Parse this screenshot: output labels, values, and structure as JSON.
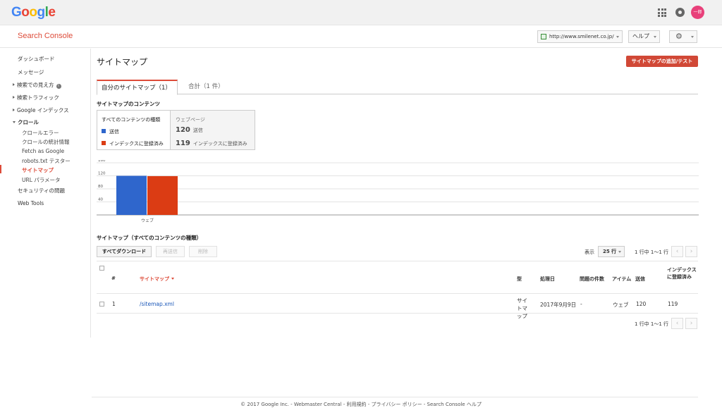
{
  "colors": {
    "brand_red": "#dd4b39",
    "sent": "#2f66cc",
    "indexed": "#db3c14",
    "link": "#1a57b8"
  },
  "topbar": {
    "logo": "Google",
    "avatar_text": "一郎"
  },
  "header": {
    "title": "Search Console",
    "site": "http://www.smilenet.co.jp/",
    "help": "ヘルプ",
    "gear": "⚙"
  },
  "sidebar": {
    "dashboard": "ダッシュボード",
    "messages": "メッセージ",
    "search_appearance": "検索での見え方",
    "search_traffic": "検索トラフィック",
    "google_index": "Google インデックス",
    "crawl": "クロール",
    "crawl_errors": "クロールエラー",
    "crawl_stats": "クロールの統計情報",
    "fetch_as_google": "Fetch as Google",
    "robots_tester": "robots.txt テスター",
    "sitemaps": "サイトマップ",
    "url_params": "URL パラメータ",
    "security": "セキュリティの問題",
    "web_tools": "Web Tools"
  },
  "main": {
    "title": "サイトマップ",
    "add_button": "サイトマップの追加/テスト",
    "tabs": [
      {
        "label": "自分のサイトマップ（1）"
      },
      {
        "label": "合計（1 件）"
      }
    ],
    "contents_title": "サイトマップのコンテンツ",
    "legend": {
      "header": "すべてのコンテンツの種類",
      "sent": "送信",
      "indexed": "インデックスに登録済み"
    },
    "stats": {
      "header": "ウェブページ",
      "sent_value": "120",
      "sent_label": "送信",
      "indexed_value": "119",
      "indexed_label": "インデックスに登録済み"
    },
    "table_title": "サイトマップ（すべてのコンテンツの種類）",
    "buttons": {
      "download_all": "すべてダウンロード",
      "resubmit": "再送信",
      "delete": "削除"
    },
    "show_label": "表示",
    "rows_per_page": "25 行",
    "page_info": "1 行中 1～1 行",
    "pager_prev": "‹",
    "pager_next": "›",
    "columns": {
      "num": "#",
      "sitemap": "サイトマップ",
      "type": "型",
      "processed": "処理日",
      "issues": "問題の件数",
      "items": "アイテム",
      "sent": "送信",
      "indexed": "インデックスに登録済み"
    },
    "rows": [
      {
        "num": "1",
        "sitemap": "/sitemap.xml",
        "type": "サイトマップ",
        "processed": "2017年9月9日",
        "issues": "-",
        "items": "ウェブ",
        "sent": "120",
        "indexed": "119"
      }
    ]
  },
  "chart_data": {
    "type": "bar",
    "categories": [
      "ウェブ"
    ],
    "series": [
      {
        "name": "送信",
        "values": [
          120
        ]
      },
      {
        "name": "インデックスに登録済み",
        "values": [
          119
        ]
      }
    ],
    "ylim": [
      0,
      160
    ],
    "yticks": [
      "40",
      "80",
      "120",
      "160"
    ],
    "grid": true
  },
  "footer": {
    "text": "© 2017 Google Inc. - Webmaster Central - 利用規約 - プライバシー ポリシー - Search Console ヘルプ"
  }
}
